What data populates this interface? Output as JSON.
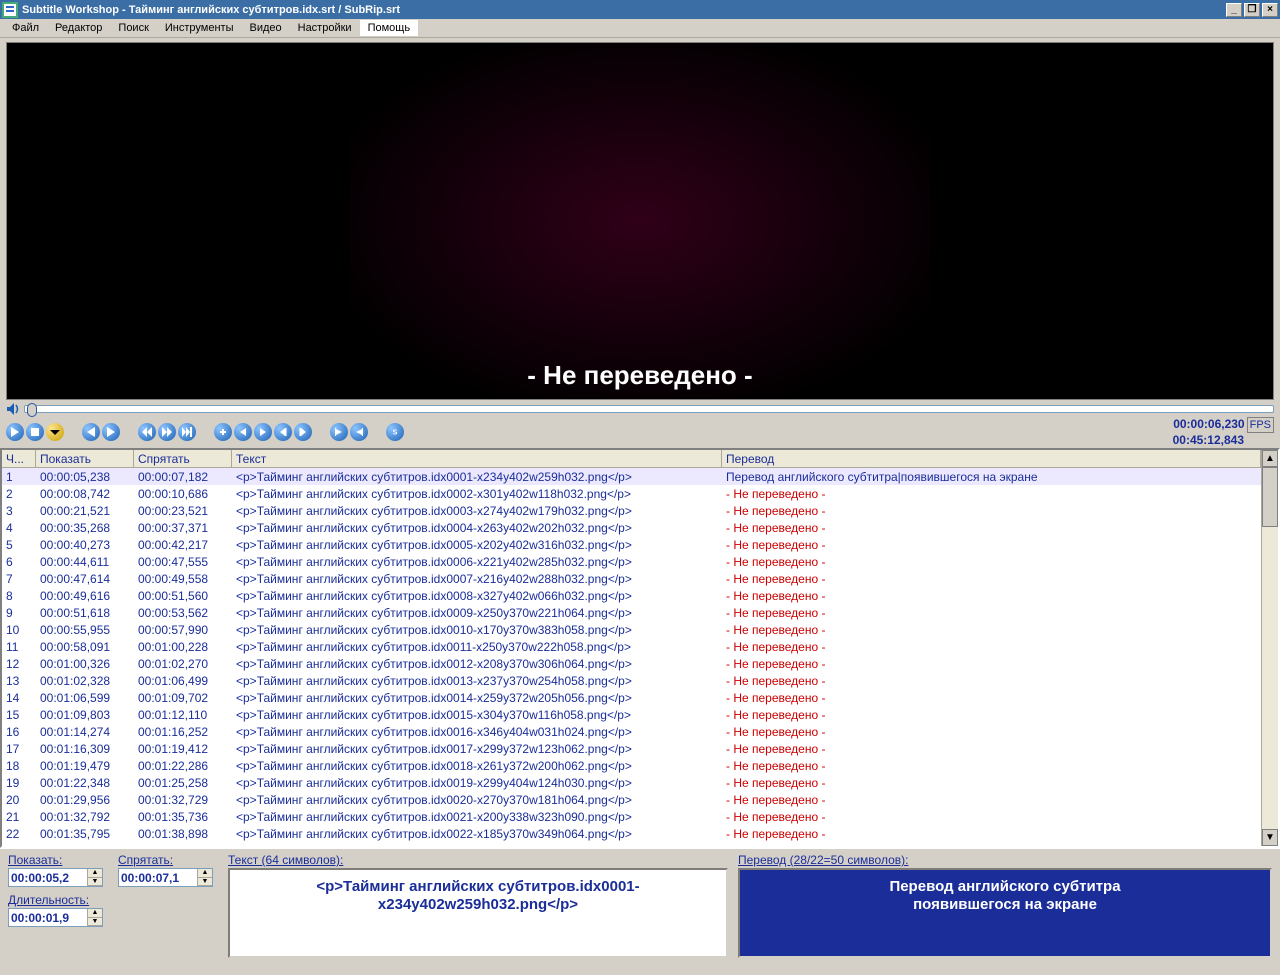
{
  "title": "Subtitle Workshop - Тайминг английских субтитров.idx.srt / SubRip.srt",
  "menu": [
    "Файл",
    "Редактор",
    "Поиск",
    "Инструменты",
    "Видео",
    "Настройки",
    "Помощь"
  ],
  "video_subtitle": "- Не переведено -",
  "time_display": {
    "current": "00:00:06,230",
    "total": "00:45:12,843",
    "fps": "FPS"
  },
  "columns": {
    "num": "Ч...",
    "show": "Показать",
    "hide": "Спрятать",
    "text": "Текст",
    "trans": "Перевод"
  },
  "not_translated": "- Не переведено -",
  "first_translation": "Перевод английского субтитра|появившегося на экране",
  "rows": [
    {
      "n": 1,
      "show": "00:00:05,238",
      "hide": "00:00:07,182",
      "text": "<p>Тайминг английских субтитров.idx0001-x234y402w259h032.png</p>"
    },
    {
      "n": 2,
      "show": "00:00:08,742",
      "hide": "00:00:10,686",
      "text": "<p>Тайминг английских субтитров.idx0002-x301y402w118h032.png</p>"
    },
    {
      "n": 3,
      "show": "00:00:21,521",
      "hide": "00:00:23,521",
      "text": "<p>Тайминг английских субтитров.idx0003-x274y402w179h032.png</p>"
    },
    {
      "n": 4,
      "show": "00:00:35,268",
      "hide": "00:00:37,371",
      "text": "<p>Тайминг английских субтитров.idx0004-x263y402w202h032.png</p>"
    },
    {
      "n": 5,
      "show": "00:00:40,273",
      "hide": "00:00:42,217",
      "text": "<p>Тайминг английских субтитров.idx0005-x202y402w316h032.png</p>"
    },
    {
      "n": 6,
      "show": "00:00:44,611",
      "hide": "00:00:47,555",
      "text": "<p>Тайминг английских субтитров.idx0006-x221y402w285h032.png</p>"
    },
    {
      "n": 7,
      "show": "00:00:47,614",
      "hide": "00:00:49,558",
      "text": "<p>Тайминг английских субтитров.idx0007-x216y402w288h032.png</p>"
    },
    {
      "n": 8,
      "show": "00:00:49,616",
      "hide": "00:00:51,560",
      "text": "<p>Тайминг английских субтитров.idx0008-x327y402w066h032.png</p>"
    },
    {
      "n": 9,
      "show": "00:00:51,618",
      "hide": "00:00:53,562",
      "text": "<p>Тайминг английских субтитров.idx0009-x250y370w221h064.png</p>"
    },
    {
      "n": 10,
      "show": "00:00:55,955",
      "hide": "00:00:57,990",
      "text": "<p>Тайминг английских субтитров.idx0010-x170y370w383h058.png</p>"
    },
    {
      "n": 11,
      "show": "00:00:58,091",
      "hide": "00:01:00,228",
      "text": "<p>Тайминг английских субтитров.idx0011-x250y370w222h058.png</p>"
    },
    {
      "n": 12,
      "show": "00:01:00,326",
      "hide": "00:01:02,270",
      "text": "<p>Тайминг английских субтитров.idx0012-x208y370w306h064.png</p>"
    },
    {
      "n": 13,
      "show": "00:01:02,328",
      "hide": "00:01:06,499",
      "text": "<p>Тайминг английских субтитров.idx0013-x237y370w254h058.png</p>"
    },
    {
      "n": 14,
      "show": "00:01:06,599",
      "hide": "00:01:09,702",
      "text": "<p>Тайминг английских субтитров.idx0014-x259y372w205h056.png</p>"
    },
    {
      "n": 15,
      "show": "00:01:09,803",
      "hide": "00:01:12,110",
      "text": "<p>Тайминг английских субтитров.idx0015-x304y370w116h058.png</p>"
    },
    {
      "n": 16,
      "show": "00:01:14,274",
      "hide": "00:01:16,252",
      "text": "<p>Тайминг английских субтитров.idx0016-x346y404w031h024.png</p>"
    },
    {
      "n": 17,
      "show": "00:01:16,309",
      "hide": "00:01:19,412",
      "text": "<p>Тайминг английских субтитров.idx0017-x299y372w123h062.png</p>"
    },
    {
      "n": 18,
      "show": "00:01:19,479",
      "hide": "00:01:22,286",
      "text": "<p>Тайминг английских субтитров.idx0018-x261y372w200h062.png</p>"
    },
    {
      "n": 19,
      "show": "00:01:22,348",
      "hide": "00:01:25,258",
      "text": "<p>Тайминг английских субтитров.idx0019-x299y404w124h030.png</p>"
    },
    {
      "n": 20,
      "show": "00:01:29,956",
      "hide": "00:01:32,729",
      "text": "<p>Тайминг английских субтитров.idx0020-x270y370w181h064.png</p>"
    },
    {
      "n": 21,
      "show": "00:01:32,792",
      "hide": "00:01:35,736",
      "text": "<p>Тайминг английских субтитров.idx0021-x200y338w323h090.png</p>"
    },
    {
      "n": 22,
      "show": "00:01:35,795",
      "hide": "00:01:38,898",
      "text": "<p>Тайминг английских субтитров.idx0022-x185y370w349h064.png</p>"
    }
  ],
  "bottom": {
    "show_label": "Показать:",
    "show_val": "00:00:05,2",
    "hide_label": "Спрятать:",
    "hide_val": "00:00:07,1",
    "dur_label": "Длительность:",
    "dur_val": "00:00:01,9",
    "text_label": "Текст (64 символов):",
    "text_val": "<p>Тайминг английских субтитров.idx0001-x234y402w259h032.png</p>",
    "trans_label": "Перевод (28/22=50 символов):",
    "trans_val": "Перевод английского субтитра\nпоявившегося на экране"
  }
}
